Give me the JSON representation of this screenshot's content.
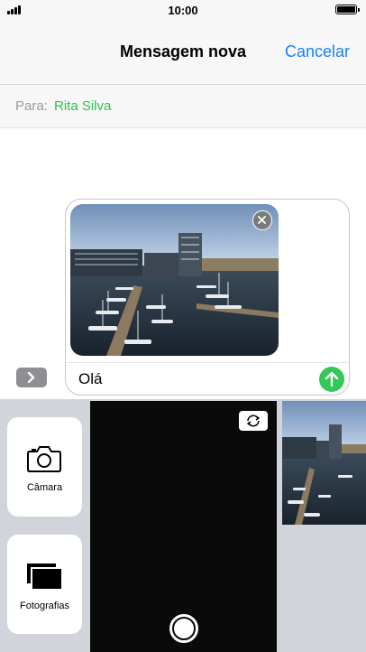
{
  "status_bar": {
    "time": "10:00",
    "signal": "signal-bars-icon",
    "battery": "battery-icon"
  },
  "nav": {
    "title": "Mensagem nova",
    "cancel_label": "Cancelar"
  },
  "recipient": {
    "label": "Para:",
    "name": "Rita Silva"
  },
  "compose": {
    "attachment": "harbor-photo",
    "message_text": "Olá",
    "remove_icon": "close-icon",
    "send_icon": "arrow-up-icon"
  },
  "drawer": {
    "camera_label": "Câmara",
    "photos_label": "Fotografias",
    "flip_icon": "camera-flip-icon",
    "shutter_icon": "shutter-icon"
  },
  "colors": {
    "accent_blue": "#1a82fb",
    "accent_green": "#34c759",
    "recipient_green": "#2bc253"
  }
}
